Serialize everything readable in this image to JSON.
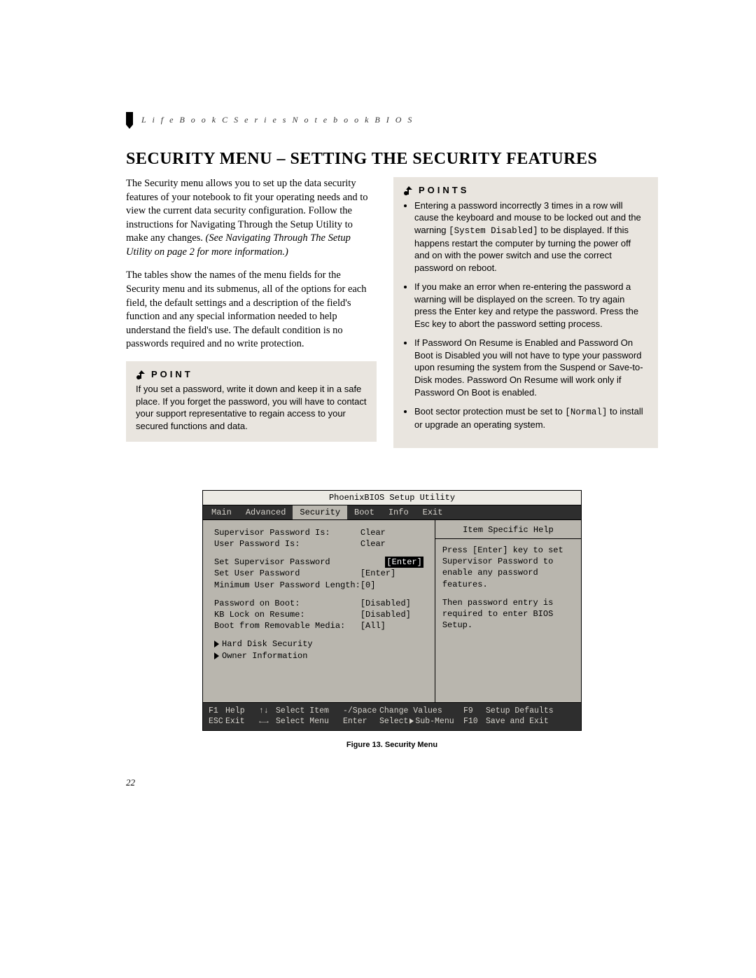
{
  "header": {
    "running_head": "L i f e B o o k  C  S e r i e s  N o t e b o o k  B I O S"
  },
  "title": "SECURITY MENU – SETTING THE SECURITY FEATURES",
  "intro": {
    "para1_a": "The Security menu allows you to set up the data security features of your notebook to fit your operating needs and to view the current data security configuration. Follow the instructions for Navigating Through the Setup Utility to make any changes. ",
    "para1_b": "(See Navigating Through The Setup Utility on page 2 for more information.)",
    "para2": "The tables show the names of the menu fields for the Security menu and its submenus, all of the options for each field, the default settings and a description of the field's function and any special information needed to help understand the field's use. The default condition is no passwords required and no write protection."
  },
  "point_box": {
    "title": "POINT",
    "body": "If you set a password, write it down and keep it in a safe place. If you forget the password, you will have to contact your support representative to regain access to your secured functions and data."
  },
  "points_box": {
    "title": "POINTS",
    "items": [
      {
        "pre": "Entering a password incorrectly 3 times in a row will cause the keyboard and mouse to be locked out and the warning ",
        "code": "[System Disabled]",
        "post": " to be displayed. If this happens restart the computer by turning the power off and on with the power switch and use the correct password on reboot."
      },
      {
        "pre": "If you make an error when re-entering the password a warning will be displayed on the screen. To try again press the Enter key and retype the password. Press the Esc key to abort the password setting process.",
        "code": "",
        "post": ""
      },
      {
        "pre": "If Password On Resume is Enabled and Password On Boot is Disabled you will not have to type your password upon resuming the system from the Suspend or Save-to-Disk modes. Password On Resume will work only if Password On Boot is enabled.",
        "code": "",
        "post": ""
      },
      {
        "pre": "Boot sector protection must be set to ",
        "code": "[Normal]",
        "post": " to install or upgrade an operating system."
      }
    ]
  },
  "bios": {
    "title": "PhoenixBIOS Setup Utility",
    "tabs": [
      "Main",
      "Advanced",
      "Security",
      "Boot",
      "Info",
      "Exit"
    ],
    "active_tab": "Security",
    "rows": [
      {
        "label": "Supervisor Password Is:",
        "value": "Clear",
        "sel": false
      },
      {
        "label": "User Password Is:",
        "value": "Clear",
        "sel": false
      }
    ],
    "rows2": [
      {
        "label": "Set Supervisor Password",
        "value": "[Enter]",
        "sel": true
      },
      {
        "label": "Set User Password",
        "value": "[Enter]",
        "sel": false
      },
      {
        "label": "Minimum User Password Length:",
        "value": "[0]",
        "sel": false
      }
    ],
    "rows3": [
      {
        "label": "Password on Boot:",
        "value": "[Disabled]",
        "sel": false
      },
      {
        "label": "KB Lock on Resume:",
        "value": "[Disabled]",
        "sel": false
      },
      {
        "label": "Boot from Removable Media:",
        "value": "[All]",
        "sel": false
      }
    ],
    "subs": [
      "Hard Disk Security",
      "Owner Information"
    ],
    "help_title": "Item Specific Help",
    "help_body1": "Press [Enter] key to set Supervisor Password to enable any password features.",
    "help_body2": "Then password entry is required to enter BIOS Setup.",
    "footer": {
      "r1": {
        "k1": "F1",
        "v1": "Help",
        "k2": "↑↓",
        "v2": "Select Item",
        "k3": "-/Space",
        "v3": "Change Values",
        "k4": "F9",
        "v4": "Setup Defaults"
      },
      "r2": {
        "k1": "ESC",
        "v1": "Exit",
        "k2": "←→",
        "v2": "Select Menu",
        "k3": "Enter",
        "v3a": "Select",
        "v3b": "Sub-Menu",
        "k4": "F10",
        "v4": "Save and Exit"
      }
    }
  },
  "figure_caption": "Figure 13.  Security Menu",
  "page_number": "22"
}
